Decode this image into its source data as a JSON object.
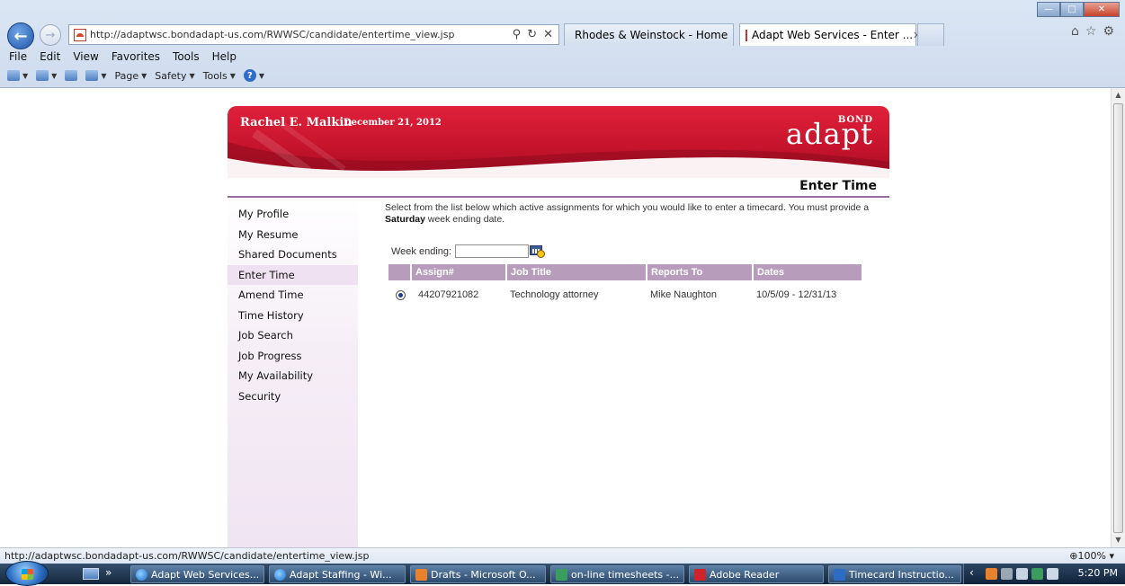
{
  "browser": {
    "url": "http://adaptwsc.bondadapt-us.com/RWWSC/candidate/entertime_view.jsp",
    "tabs": [
      {
        "label": "Rhodes & Weinstock - Home"
      },
      {
        "label": "Adapt Web Services - Enter ..."
      }
    ],
    "menu": [
      "File",
      "Edit",
      "View",
      "Favorites",
      "Tools",
      "Help"
    ],
    "commands": [
      "Page",
      "Safety",
      "Tools"
    ]
  },
  "site": {
    "user_name": "Rachel E. Malkin",
    "date": "December 21, 2012",
    "logo_top": "BOND",
    "logo_main": "adapt",
    "page_title": "Enter Time",
    "sidebar": [
      {
        "label": "My Profile"
      },
      {
        "label": "My Resume"
      },
      {
        "label": "Shared Documents"
      },
      {
        "label": "Enter Time",
        "active": true
      },
      {
        "label": "Amend Time"
      },
      {
        "label": "Time History"
      },
      {
        "label": "Job Search"
      },
      {
        "label": "Job Progress"
      },
      {
        "label": "My Availability"
      },
      {
        "label": "Security"
      }
    ],
    "instructions_pre": "Select from the list below which active assignments for which you would like to enter a timecard. You must provide a ",
    "instructions_bold": "Saturday",
    "instructions_post": " week ending date.",
    "week_ending_label": "Week ending:",
    "week_ending_value": "",
    "table": {
      "headers": [
        "Assign#",
        "Job Title",
        "Reports To",
        "Dates"
      ],
      "rows": [
        {
          "assign": "44207921082",
          "title": "Technology attorney",
          "reports_to": "Mike Naughton",
          "dates": "10/5/09 - 12/31/13",
          "selected": true
        }
      ]
    }
  },
  "status_bar": {
    "text": "http://adaptwsc.bondadapt-us.com/RWWSC/candidate/entertime_view.jsp",
    "zoom": "100%"
  },
  "taskbar": {
    "items": [
      {
        "label": "Adapt Web Services..."
      },
      {
        "label": "Adapt Staffing - Wi..."
      },
      {
        "label": "Drafts - Microsoft O..."
      },
      {
        "label": "on-line timesheets -..."
      },
      {
        "label": "Adobe Reader"
      },
      {
        "label": "Timecard Instructio..."
      }
    ],
    "clock": "5:20 PM"
  },
  "colors": {
    "header_red": "#c7142d",
    "accent_purple": "#b79cbc",
    "sidebar_tint": "#efe1f1"
  }
}
